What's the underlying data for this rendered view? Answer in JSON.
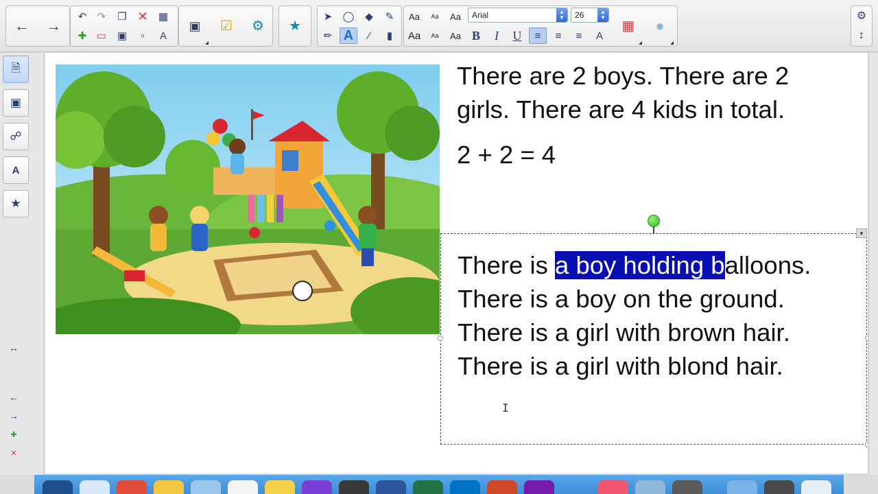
{
  "toolbar": {
    "font_name": "Arial",
    "font_size": "26",
    "text_style_labels": [
      "Aa",
      "Aa",
      "Aa",
      "Aa",
      "Aa",
      "Aa"
    ],
    "bold_label": "B",
    "italic_label": "I",
    "underline_label": "U",
    "text_tool_label": "A"
  },
  "document": {
    "intro_lines": [
      "There are 2 boys. There are 2",
      "girls. There are 4 kids in total."
    ],
    "equation": "2 + 2 = 4",
    "selected_textbox": {
      "line1_before": "There is ",
      "line1_selected": "a boy holding b",
      "line1_after": "alloons.",
      "line2": "There is a boy on the ground.",
      "line3": "There is a girl with brown hair.",
      "line4": "There is a girl with blond hair."
    }
  },
  "colors": {
    "selection_highlight": "#0a0fb4",
    "rotation_handle": "#3cc41f",
    "dock": "#4a9be0"
  },
  "icons": {
    "toolbar": [
      "back-arrow-icon",
      "forward-arrow-icon",
      "undo-icon",
      "redo-icon",
      "paste-icon",
      "delete-icon",
      "table-icon",
      "new-page-icon",
      "delete-page-icon",
      "save-icon",
      "screen-shade-icon",
      "text-format-icon",
      "display-icon",
      "check-icon",
      "gallery-icon",
      "add-ons-icon",
      "select-icon",
      "shape-icon",
      "fill-icon",
      "magic-pen-icon",
      "pen-icon",
      "line-icon",
      "eraser-icon",
      "color-grid-icon",
      "properties-icon",
      "settings-icon",
      "collapse-icon"
    ],
    "sidebar": [
      "page-sorter-icon",
      "gallery-icon",
      "attachments-icon",
      "properties-icon",
      "add-ons-icon",
      "resize-icon",
      "previous-page-icon",
      "next-page-icon",
      "add-page-icon",
      "delete-page-icon"
    ]
  }
}
